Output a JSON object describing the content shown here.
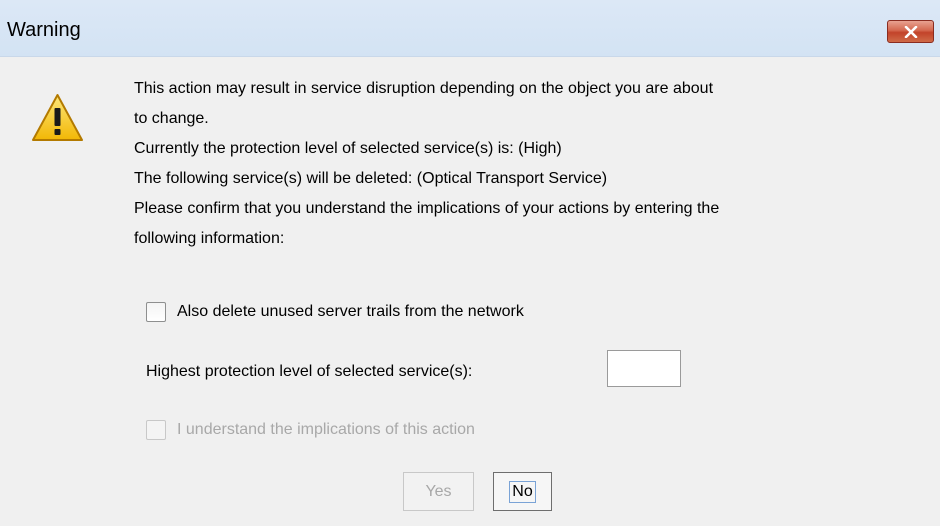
{
  "window": {
    "title": "Warning",
    "close_label": "Close"
  },
  "message": {
    "lines": [
      "This action may result in service disruption depending on the object you are about",
      "to change.",
      "Currently the protection level of selected service(s) is: (High)",
      "The following service(s) will be deleted: (Optical Transport Service)",
      "Please confirm that you understand the implications of your actions by entering the",
      "following information:"
    ]
  },
  "options": {
    "delete_trails_label": "Also delete unused server trails from the network",
    "delete_trails_checked": false,
    "protection_label": "Highest protection level of selected service(s):",
    "protection_value": "",
    "understand_label": "I understand the implications of this action",
    "understand_checked": false,
    "understand_enabled": false
  },
  "buttons": {
    "yes_label": "Yes",
    "yes_enabled": false,
    "no_label": "No"
  },
  "colors": {
    "titlebar": "#d3e3f4",
    "close_button": "#c7472e",
    "warning_icon": "#f7c325",
    "disabled_text": "#a8a8a8"
  }
}
